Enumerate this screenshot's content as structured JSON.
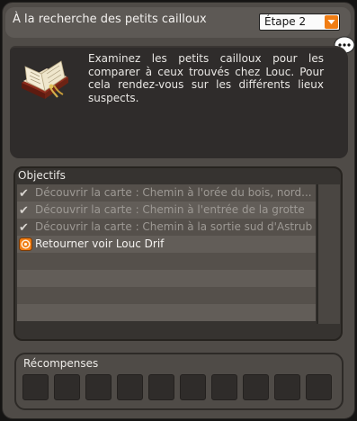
{
  "quest": {
    "title": "À la recherche des petits cailloux",
    "stage": "Étape 2",
    "description": "Examinez les petits cailloux pour les comparer à ceux trouvés chez Louc. Pour cela rendez-vous sur les différents lieux suspects."
  },
  "objectives": {
    "header": "Objectifs",
    "items": [
      {
        "text": "Découvrir la carte : Chemin à l'orée du bois, nord...",
        "state": "done"
      },
      {
        "text": "Découvrir la carte : Chemin à l'entrée de la grotte",
        "state": "done"
      },
      {
        "text": "Découvrir la carte : Chemin à la sortie sud d'Astrub",
        "state": "done"
      },
      {
        "text": "Retourner voir Louc Drif",
        "state": "active"
      }
    ],
    "empty_rows": 5
  },
  "rewards": {
    "header": "Récompenses",
    "slot_count": 10
  },
  "colors": {
    "accent": "#f07d14"
  }
}
